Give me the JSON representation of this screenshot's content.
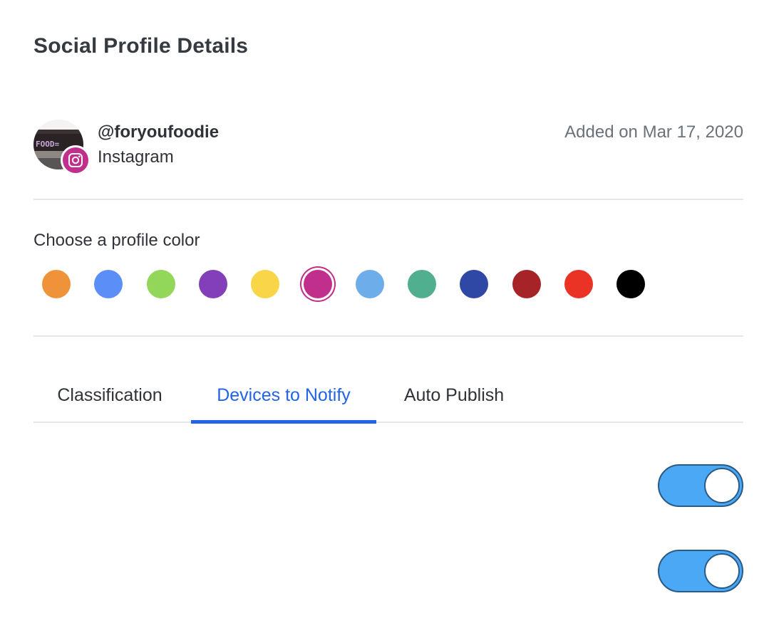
{
  "page": {
    "title": "Social Profile Details"
  },
  "profile": {
    "handle": "@foryoufoodie",
    "network": "Instagram",
    "added_on": "Added on Mar 17, 2020",
    "avatar_icon": "avatar-photo",
    "badge_icon": "instagram-icon",
    "badge_color": "#c02f8c"
  },
  "color_picker": {
    "label": "Choose a profile color",
    "selected": "#c02f8c",
    "colors": [
      "#f0923a",
      "#5b8ef7",
      "#92d65a",
      "#833fba",
      "#f9d548",
      "#c02f8c",
      "#6daeea",
      "#4faf8f",
      "#2f47a5",
      "#a62427",
      "#ea3225",
      "#000000"
    ]
  },
  "tabs": {
    "items": [
      {
        "label": "Classification",
        "active": false
      },
      {
        "label": "Devices to Notify",
        "active": true
      },
      {
        "label": "Auto Publish",
        "active": false
      }
    ]
  },
  "devices": {
    "items": [
      {
        "name": "",
        "enabled": true
      },
      {
        "name": "",
        "enabled": true
      }
    ]
  },
  "colors": {
    "accent": "#2363e7",
    "toggle_on": "#4aa8f5"
  }
}
